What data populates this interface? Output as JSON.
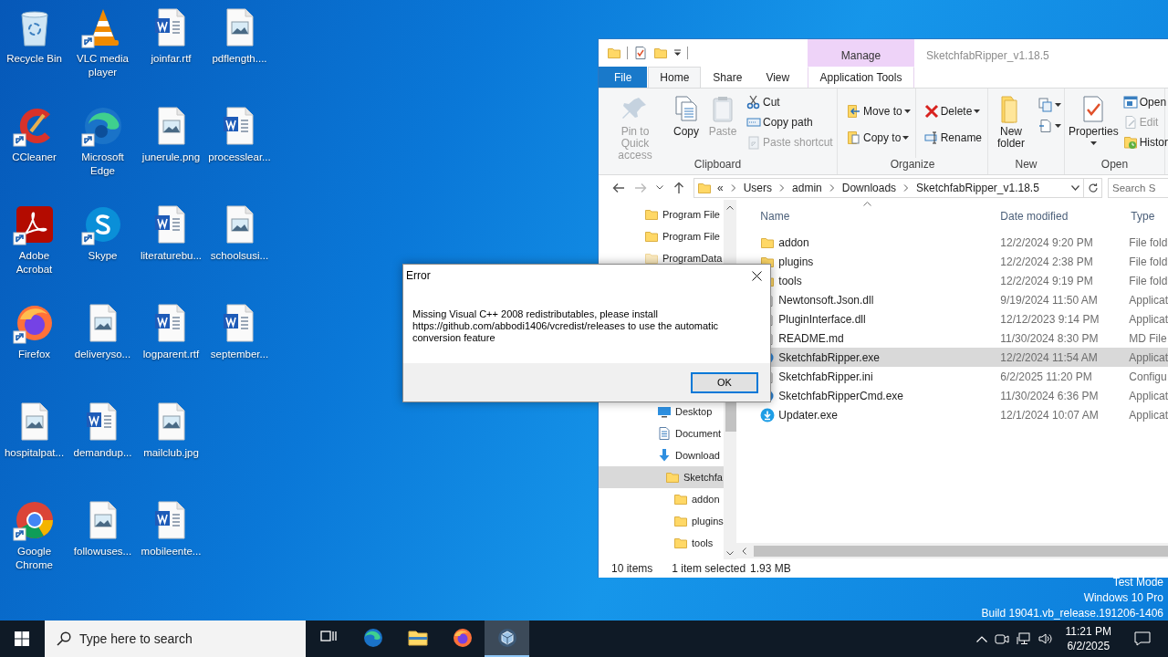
{
  "desktop_icons": [
    {
      "label": "Recycle Bin",
      "kind": "recycle-bin",
      "shortcut": false
    },
    {
      "label": "CCleaner",
      "kind": "ccleaner",
      "shortcut": true
    },
    {
      "label": "Adobe Acrobat",
      "kind": "acrobat",
      "shortcut": true
    },
    {
      "label": "Firefox",
      "kind": "firefox",
      "shortcut": true
    },
    {
      "label": "hospitalpat...",
      "kind": "image",
      "shortcut": false
    },
    {
      "label": "Google Chrome",
      "kind": "chrome",
      "shortcut": true
    },
    {
      "label": "VLC media player",
      "kind": "vlc",
      "shortcut": true
    },
    {
      "label": "Microsoft Edge",
      "kind": "edge",
      "shortcut": true
    },
    {
      "label": "Skype",
      "kind": "skype",
      "shortcut": true
    },
    {
      "label": "deliveryso...",
      "kind": "image",
      "shortcut": false
    },
    {
      "label": "demandup...",
      "kind": "word",
      "shortcut": false
    },
    {
      "label": "followuses...",
      "kind": "image",
      "shortcut": false
    },
    {
      "label": "joinfar.rtf",
      "kind": "word",
      "shortcut": false
    },
    {
      "label": "junerule.png",
      "kind": "image",
      "shortcut": false
    },
    {
      "label": "literaturebu...",
      "kind": "word",
      "shortcut": false
    },
    {
      "label": "logparent.rtf",
      "kind": "word",
      "shortcut": false
    },
    {
      "label": "mailclub.jpg",
      "kind": "image",
      "shortcut": false
    },
    {
      "label": "mobileente...",
      "kind": "word",
      "shortcut": false
    },
    {
      "label": "pdflength....",
      "kind": "image",
      "shortcut": false
    },
    {
      "label": "processlear...",
      "kind": "word",
      "shortcut": false
    },
    {
      "label": "schoolsusi...",
      "kind": "image",
      "shortcut": false
    },
    {
      "label": "september...",
      "kind": "word",
      "shortcut": false
    }
  ],
  "explorer": {
    "title": "SketchfabRipper_v1.18.5",
    "context_tab": "Manage",
    "tabs": [
      {
        "label": "File",
        "kind": "file",
        "selected": false
      },
      {
        "label": "Home",
        "kind": "tab",
        "selected": true
      },
      {
        "label": "Share",
        "kind": "tab",
        "selected": false
      },
      {
        "label": "View",
        "kind": "tab",
        "selected": false
      },
      {
        "label": "Application Tools",
        "kind": "context",
        "selected": false
      }
    ],
    "ribbon": [
      {
        "label": "Clipboard",
        "columns": [
          [
            {
              "label": "Pin to Quick access",
              "kind": "large",
              "disabled": true
            }
          ],
          [
            {
              "label": "Copy",
              "kind": "large",
              "disabled": false
            }
          ],
          [
            {
              "label": "Paste",
              "kind": "large",
              "disabled": true
            }
          ],
          [
            {
              "label": "Cut",
              "kind": "small",
              "disabled": false
            },
            {
              "label": "Copy path",
              "kind": "small",
              "disabled": false
            },
            {
              "label": "Paste shortcut",
              "kind": "small",
              "disabled": true
            }
          ]
        ]
      },
      {
        "label": "Organize",
        "columns": [
          [
            {
              "label": "Move to",
              "kind": "small",
              "disabled": false,
              "dropdown": true
            },
            {
              "label": "Copy to",
              "kind": "small",
              "disabled": false,
              "dropdown": true
            }
          ],
          [
            {
              "label": "Delete",
              "kind": "small",
              "disabled": false,
              "dropdown": true
            },
            {
              "label": "Rename",
              "kind": "small",
              "disabled": false
            }
          ]
        ]
      },
      {
        "label": "New",
        "columns": [
          [
            {
              "label": "New folder",
              "kind": "large",
              "disabled": false
            }
          ],
          [
            {
              "kind": "icon",
              "disabled": false,
              "dropdown": true
            },
            {
              "kind": "icon",
              "disabled": false,
              "dropdown": true
            }
          ]
        ]
      },
      {
        "label": "Open",
        "columns": [
          [
            {
              "label": "Properties",
              "kind": "large",
              "disabled": false,
              "dropdown": true
            }
          ],
          [
            {
              "label": "Open",
              "kind": "small",
              "disabled": false
            },
            {
              "label": "Edit",
              "kind": "small",
              "disabled": true
            },
            {
              "label": "Histor",
              "kind": "small",
              "disabled": false
            }
          ]
        ]
      }
    ],
    "address": {
      "overflow": "«",
      "crumbs": [
        "Users",
        "admin",
        "Downloads",
        "SketchfabRipper_v1.18.5"
      ]
    },
    "search": {
      "placeholder": "Search S"
    },
    "nav": [
      {
        "items": [
          {
            "label": "Program File",
            "kind": "folder",
            "selected": false
          },
          {
            "label": "Program File",
            "kind": "folder",
            "selected": false
          },
          {
            "label": "ProgramData",
            "kind": "hidden-folder",
            "selected": false
          }
        ]
      },
      {
        "items": [
          {
            "label": "Desktop",
            "kind": "desktop",
            "selected": false
          },
          {
            "label": "Document",
            "kind": "documents",
            "selected": false
          },
          {
            "label": "Download",
            "kind": "downloads",
            "selected": false,
            "children": [
              {
                "label": "Sketchfa",
                "kind": "folder",
                "selected": true,
                "children": [
                  {
                    "label": "addon",
                    "kind": "folder",
                    "selected": false
                  },
                  {
                    "label": "plugins",
                    "kind": "folder",
                    "selected": false
                  },
                  {
                    "label": "tools",
                    "kind": "folder",
                    "selected": false
                  }
                ]
              }
            ]
          }
        ]
      }
    ],
    "columns": [
      "Name",
      "Date modified",
      "Type"
    ],
    "files": [
      {
        "name": "addon",
        "date": "12/2/2024 9:20 PM",
        "type": "File fold",
        "kind": "folder",
        "selected": false
      },
      {
        "name": "plugins",
        "date": "12/2/2024 2:38 PM",
        "type": "File fold",
        "kind": "folder",
        "selected": false
      },
      {
        "name": "tools",
        "date": "12/2/2024 9:19 PM",
        "type": "File fold",
        "kind": "folder",
        "selected": false
      },
      {
        "name": "Newtonsoft.Json.dll",
        "date": "9/19/2024 11:50 AM",
        "type": "Applicat",
        "kind": "dll",
        "selected": false
      },
      {
        "name": "PluginInterface.dll",
        "date": "12/12/2023 9:14 PM",
        "type": "Applicat",
        "kind": "dll",
        "selected": false
      },
      {
        "name": "README.md",
        "date": "11/30/2024 8:30 PM",
        "type": "MD File",
        "kind": "text",
        "selected": false
      },
      {
        "name": "SketchfabRipper.exe",
        "date": "12/2/2024 11:54 AM",
        "type": "Applicat",
        "kind": "app",
        "selected": true
      },
      {
        "name": "SketchfabRipper.ini",
        "date": "6/2/2025 11:20 PM",
        "type": "Configu",
        "kind": "settings",
        "selected": false
      },
      {
        "name": "SketchfabRipperCmd.exe",
        "date": "11/30/2024 6:36 PM",
        "type": "Applicat",
        "kind": "app",
        "selected": false
      },
      {
        "name": "Updater.exe",
        "date": "12/1/2024 10:07 AM",
        "type": "Applicat",
        "kind": "updater",
        "selected": false
      }
    ],
    "status": {
      "count": "10 items",
      "selection": "1 item selected",
      "size": "1.93 MB"
    }
  },
  "dialog": {
    "title": "Error",
    "message": "Missing Visual C++ 2008 redistributables, please install https://github.com/abbodi1406/vcredist/releases to use the automatic conversion feature",
    "button": "OK"
  },
  "system_text": [
    "Test Mode",
    "Windows 10 Pro",
    "Build 19041.vb_release.191206-1406"
  ],
  "taskbar": {
    "search_placeholder": "Type here to search",
    "apps": [
      {
        "kind": "task-view",
        "active": false
      },
      {
        "kind": "edge",
        "active": false
      },
      {
        "kind": "explorer",
        "active": false
      },
      {
        "kind": "firefox",
        "active": false
      },
      {
        "kind": "app",
        "active": true
      }
    ],
    "time": "11:21 PM",
    "date": "6/2/2025"
  }
}
